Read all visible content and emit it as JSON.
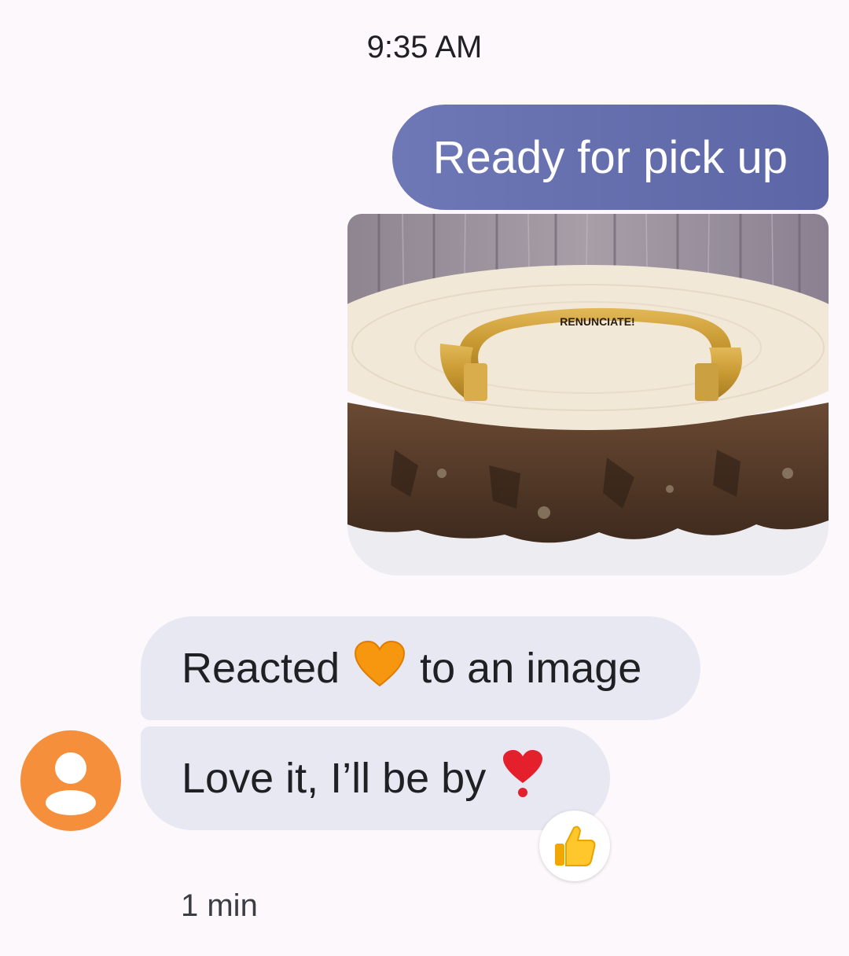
{
  "conversation": {
    "timestamp": "9:35 AM",
    "outgoing": {
      "text": "Ready for pick up",
      "image": {
        "engraving": "RENUNCIATE!"
      }
    },
    "incoming": {
      "reaction_message": {
        "before": "Reacted",
        "emoji": "orange-heart-icon",
        "after": "to an image"
      },
      "message": {
        "text": "Love it, I’ll be by",
        "emoji": "red-exclamation-icon",
        "reaction": "thumbs-up-icon"
      },
      "sender_avatar": "person-icon",
      "meta_time": "1 min"
    }
  },
  "colors": {
    "background": "#fcf8fb",
    "outgoing_bubble": "#6a73b2",
    "incoming_bubble": "#e8e8f2",
    "avatar": "#f58f3c"
  }
}
